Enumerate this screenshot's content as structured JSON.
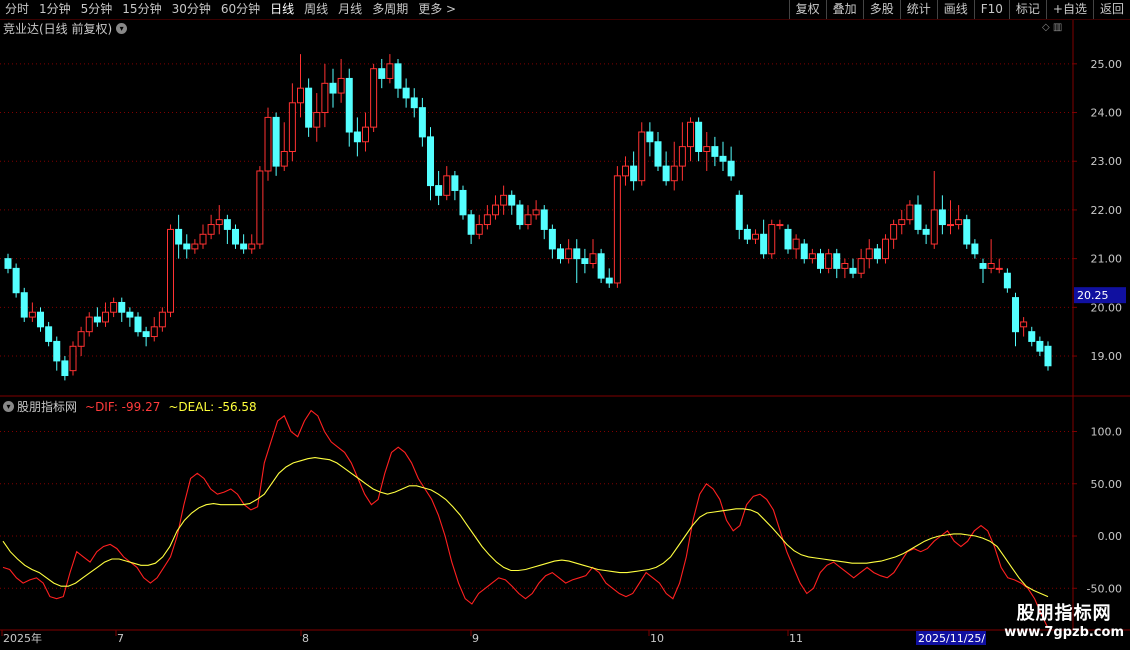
{
  "toolbar": {
    "periods": [
      "分时",
      "1分钟",
      "5分钟",
      "15分钟",
      "30分钟",
      "60分钟",
      "日线",
      "周线",
      "月线",
      "多周期",
      "更多 >"
    ],
    "active_period": "日线",
    "tools": [
      "复权",
      "叠加",
      "多股",
      "统计",
      "画线",
      "F10",
      "标记",
      "+自选",
      "返回"
    ]
  },
  "price_panel": {
    "title": "竞业达(日线 前复权)",
    "current_price_tag": "20.25",
    "y_ticks": [
      "25.00",
      "24.00",
      "23.00",
      "22.00",
      "21.00",
      "20.00",
      "19.00"
    ]
  },
  "indicator_panel": {
    "name": "股朋指标网",
    "dif_label": "~DIF: -99.27",
    "deal_label": "~DEAL: -56.58",
    "y_ticks": [
      "100.0",
      "50.00",
      "0.00",
      "-50.00"
    ]
  },
  "x_axis": {
    "labels": [
      "2025年",
      "7",
      "8",
      "9",
      "10",
      "11",
      "2025/11/25/"
    ]
  },
  "watermark": {
    "line1": "股朋指标网",
    "line2": "www.7gpzb.com"
  },
  "colors": {
    "up": "#ff3232",
    "down": "#54ffff",
    "dif": "#ff2020",
    "deal": "#ffff40",
    "grid": "#800000",
    "axis_bg": "#000000",
    "price_tag_bg": "#1010a0"
  },
  "chart_data": [
    {
      "type": "candlestick",
      "title": "竞业达(日线 前复权)",
      "ylim": [
        18.2,
        25.9
      ],
      "candles": [
        [
          21.0,
          20.8,
          21.1,
          20.7
        ],
        [
          20.8,
          20.3,
          20.9,
          20.2
        ],
        [
          20.3,
          19.8,
          20.4,
          19.7
        ],
        [
          19.8,
          19.9,
          20.1,
          19.7
        ],
        [
          19.9,
          19.6,
          20.0,
          19.5
        ],
        [
          19.6,
          19.3,
          19.7,
          19.2
        ],
        [
          19.3,
          18.9,
          19.4,
          18.7
        ],
        [
          18.9,
          18.6,
          19.0,
          18.5
        ],
        [
          18.7,
          19.2,
          19.3,
          18.6
        ],
        [
          19.2,
          19.5,
          19.6,
          19.0
        ],
        [
          19.5,
          19.8,
          19.9,
          19.4
        ],
        [
          19.8,
          19.7,
          20.0,
          19.6
        ],
        [
          19.7,
          19.9,
          20.1,
          19.6
        ],
        [
          19.9,
          20.1,
          20.2,
          19.8
        ],
        [
          20.1,
          19.9,
          20.2,
          19.7
        ],
        [
          19.9,
          19.8,
          20.0,
          19.6
        ],
        [
          19.8,
          19.5,
          19.9,
          19.4
        ],
        [
          19.5,
          19.4,
          19.6,
          19.2
        ],
        [
          19.4,
          19.6,
          19.8,
          19.3
        ],
        [
          19.6,
          19.9,
          20.0,
          19.5
        ],
        [
          19.9,
          21.6,
          21.7,
          19.8
        ],
        [
          21.6,
          21.3,
          21.9,
          21.0
        ],
        [
          21.3,
          21.2,
          21.5,
          21.0
        ],
        [
          21.2,
          21.3,
          21.4,
          21.1
        ],
        [
          21.3,
          21.5,
          21.7,
          21.2
        ],
        [
          21.5,
          21.7,
          21.9,
          21.4
        ],
        [
          21.7,
          21.8,
          22.1,
          21.5
        ],
        [
          21.8,
          21.6,
          21.9,
          21.3
        ],
        [
          21.6,
          21.3,
          21.7,
          21.2
        ],
        [
          21.3,
          21.2,
          21.5,
          21.1
        ],
        [
          21.2,
          21.3,
          21.5,
          21.1
        ],
        [
          21.3,
          22.8,
          22.9,
          21.2
        ],
        [
          22.8,
          23.9,
          24.1,
          22.6
        ],
        [
          23.9,
          22.9,
          24.0,
          22.7
        ],
        [
          22.9,
          23.2,
          23.8,
          22.8
        ],
        [
          23.2,
          24.2,
          24.6,
          23.0
        ],
        [
          24.2,
          24.5,
          25.2,
          23.9
        ],
        [
          24.5,
          23.7,
          24.7,
          23.5
        ],
        [
          23.7,
          24.0,
          24.4,
          23.4
        ],
        [
          24.0,
          24.6,
          25.0,
          23.7
        ],
        [
          24.6,
          24.4,
          24.9,
          24.1
        ],
        [
          24.4,
          24.7,
          25.1,
          24.2
        ],
        [
          24.7,
          23.6,
          24.9,
          23.3
        ],
        [
          23.6,
          23.4,
          23.9,
          23.1
        ],
        [
          23.4,
          23.7,
          24.0,
          23.2
        ],
        [
          23.7,
          24.9,
          25.0,
          23.6
        ],
        [
          24.9,
          24.7,
          25.1,
          24.5
        ],
        [
          24.7,
          25.0,
          25.2,
          24.6
        ],
        [
          25.0,
          24.5,
          25.1,
          24.3
        ],
        [
          24.5,
          24.3,
          24.7,
          24.1
        ],
        [
          24.3,
          24.1,
          24.5,
          23.9
        ],
        [
          24.1,
          23.5,
          24.3,
          23.3
        ],
        [
          23.5,
          22.5,
          23.7,
          22.2
        ],
        [
          22.5,
          22.3,
          22.8,
          22.1
        ],
        [
          22.3,
          22.7,
          22.9,
          22.2
        ],
        [
          22.7,
          22.4,
          22.8,
          22.2
        ],
        [
          22.4,
          21.9,
          22.5,
          21.8
        ],
        [
          21.9,
          21.5,
          22.0,
          21.3
        ],
        [
          21.5,
          21.7,
          21.9,
          21.4
        ],
        [
          21.7,
          21.9,
          22.1,
          21.6
        ],
        [
          21.9,
          22.1,
          22.3,
          21.8
        ],
        [
          22.1,
          22.3,
          22.5,
          21.9
        ],
        [
          22.3,
          22.1,
          22.4,
          21.9
        ],
        [
          22.1,
          21.7,
          22.2,
          21.6
        ],
        [
          21.7,
          21.9,
          22.1,
          21.6
        ],
        [
          21.9,
          22.0,
          22.2,
          21.8
        ],
        [
          22.0,
          21.6,
          22.1,
          21.4
        ],
        [
          21.6,
          21.2,
          21.7,
          21.0
        ],
        [
          21.2,
          21.0,
          21.3,
          20.9
        ],
        [
          21.0,
          21.2,
          21.4,
          20.9
        ],
        [
          21.2,
          21.0,
          21.4,
          20.5
        ],
        [
          21.0,
          20.9,
          21.2,
          20.7
        ],
        [
          20.9,
          21.1,
          21.4,
          20.8
        ],
        [
          21.1,
          20.6,
          21.2,
          20.5
        ],
        [
          20.6,
          20.5,
          20.8,
          20.4
        ],
        [
          20.5,
          22.7,
          22.9,
          20.4
        ],
        [
          22.7,
          22.9,
          23.1,
          22.5
        ],
        [
          22.9,
          22.6,
          23.2,
          22.4
        ],
        [
          22.6,
          23.6,
          23.8,
          22.5
        ],
        [
          23.6,
          23.4,
          23.8,
          23.1
        ],
        [
          23.4,
          22.9,
          23.6,
          22.8
        ],
        [
          22.9,
          22.6,
          23.2,
          22.5
        ],
        [
          22.6,
          22.9,
          23.4,
          22.4
        ],
        [
          22.9,
          23.3,
          23.8,
          22.6
        ],
        [
          23.3,
          23.8,
          23.9,
          23.0
        ],
        [
          23.8,
          23.2,
          23.9,
          23.0
        ],
        [
          23.2,
          23.3,
          23.6,
          22.8
        ],
        [
          23.3,
          23.1,
          23.5,
          22.9
        ],
        [
          23.1,
          23.0,
          23.4,
          22.8
        ],
        [
          23.0,
          22.7,
          23.3,
          22.6
        ],
        [
          22.3,
          21.6,
          22.4,
          21.4
        ],
        [
          21.6,
          21.4,
          21.7,
          21.3
        ],
        [
          21.4,
          21.5,
          21.6,
          21.3
        ],
        [
          21.5,
          21.1,
          21.8,
          21.0
        ],
        [
          21.1,
          21.7,
          21.8,
          21.0
        ],
        [
          21.7,
          21.7,
          21.8,
          21.6
        ],
        [
          21.6,
          21.2,
          21.7,
          21.1
        ],
        [
          21.2,
          21.4,
          21.5,
          21.0
        ],
        [
          21.3,
          21.0,
          21.4,
          20.9
        ],
        [
          21.0,
          21.1,
          21.2,
          20.9
        ],
        [
          21.1,
          20.8,
          21.2,
          20.7
        ],
        [
          20.8,
          21.1,
          21.2,
          20.7
        ],
        [
          21.1,
          20.8,
          21.2,
          20.6
        ],
        [
          20.8,
          20.9,
          21.0,
          20.6
        ],
        [
          20.8,
          20.7,
          21.0,
          20.6
        ],
        [
          20.7,
          21.0,
          21.2,
          20.6
        ],
        [
          21.0,
          21.2,
          21.4,
          20.8
        ],
        [
          21.2,
          21.0,
          21.3,
          20.9
        ],
        [
          21.0,
          21.4,
          21.5,
          20.9
        ],
        [
          21.4,
          21.7,
          21.8,
          21.2
        ],
        [
          21.7,
          21.8,
          22.0,
          21.5
        ],
        [
          21.8,
          22.1,
          22.2,
          21.7
        ],
        [
          22.1,
          21.6,
          22.3,
          21.5
        ],
        [
          21.6,
          21.5,
          21.7,
          21.3
        ],
        [
          21.3,
          22.0,
          22.8,
          21.2
        ],
        [
          22.0,
          21.7,
          22.3,
          21.5
        ],
        [
          21.7,
          21.7,
          22.2,
          21.5
        ],
        [
          21.7,
          21.8,
          22.1,
          21.6
        ],
        [
          21.8,
          21.3,
          21.9,
          21.2
        ],
        [
          21.3,
          21.1,
          21.4,
          21.0
        ],
        [
          20.9,
          20.8,
          21.0,
          20.5
        ],
        [
          20.8,
          20.9,
          21.4,
          20.7
        ],
        [
          20.8,
          20.8,
          21.0,
          20.7
        ],
        [
          20.7,
          20.4,
          20.8,
          20.3
        ],
        [
          20.2,
          19.5,
          20.3,
          19.2
        ],
        [
          19.6,
          19.7,
          19.8,
          19.4
        ],
        [
          19.5,
          19.3,
          19.6,
          19.2
        ],
        [
          19.3,
          19.1,
          19.4,
          19.0
        ],
        [
          19.2,
          18.8,
          19.3,
          18.7
        ]
      ]
    },
    {
      "type": "line",
      "title": "股朋指标网",
      "ylim": [
        -88,
        133
      ],
      "series": [
        {
          "name": "DIF",
          "values": [
            -30,
            -32,
            -40,
            -45,
            -42,
            -40,
            -45,
            -58,
            -60,
            -58,
            -35,
            -15,
            -20,
            -25,
            -15,
            -10,
            -8,
            -12,
            -20,
            -25,
            -30,
            -40,
            -45,
            -40,
            -30,
            -20,
            0,
            30,
            55,
            60,
            55,
            45,
            40,
            42,
            45,
            40,
            30,
            25,
            28,
            70,
            90,
            110,
            115,
            100,
            95,
            110,
            120,
            115,
            100,
            90,
            85,
            80,
            70,
            55,
            40,
            30,
            35,
            60,
            80,
            85,
            80,
            70,
            55,
            45,
            35,
            20,
            0,
            -25,
            -45,
            -60,
            -65,
            -55,
            -50,
            -45,
            -40,
            -42,
            -48,
            -55,
            -60,
            -55,
            -45,
            -38,
            -35,
            -40,
            -45,
            -42,
            -40,
            -38,
            -30,
            -35,
            -45,
            -50,
            -55,
            -58,
            -55,
            -45,
            -35,
            -40,
            -45,
            -55,
            -60,
            -45,
            -20,
            15,
            40,
            50,
            45,
            35,
            15,
            5,
            10,
            30,
            38,
            40,
            35,
            25,
            5,
            -15,
            -30,
            -45,
            -55,
            -50,
            -35,
            -28,
            -25,
            -30,
            -35,
            -40,
            -35,
            -30,
            -35,
            -38,
            -40,
            -35,
            -25,
            -15,
            -12,
            -15,
            -12,
            -5,
            0,
            5,
            -5,
            -10,
            -5,
            5,
            10,
            5,
            -10,
            -30,
            -40,
            -42,
            -45,
            -50,
            -60,
            -75,
            -88
          ]
        },
        {
          "name": "DEAL",
          "values": [
            -5,
            -15,
            -22,
            -28,
            -32,
            -35,
            -40,
            -45,
            -48,
            -48,
            -45,
            -40,
            -35,
            -30,
            -25,
            -22,
            -22,
            -24,
            -26,
            -28,
            -28,
            -26,
            -20,
            -10,
            5,
            15,
            22,
            27,
            30,
            31,
            30,
            30,
            30,
            30,
            31,
            35,
            40,
            50,
            60,
            66,
            70,
            72,
            74,
            75,
            74,
            73,
            70,
            65,
            60,
            55,
            50,
            45,
            42,
            40,
            42,
            45,
            48,
            48,
            46,
            44,
            40,
            35,
            28,
            20,
            10,
            0,
            -10,
            -18,
            -25,
            -30,
            -33,
            -33,
            -32,
            -30,
            -28,
            -26,
            -24,
            -23,
            -24,
            -26,
            -28,
            -30,
            -32,
            -33,
            -34,
            -35,
            -35,
            -34,
            -33,
            -32,
            -30,
            -26,
            -20,
            -10,
            0,
            10,
            18,
            22,
            23,
            24,
            25,
            26,
            26,
            25,
            22,
            15,
            8,
            0,
            -8,
            -14,
            -18,
            -20,
            -21,
            -22,
            -23,
            -24,
            -25,
            -26,
            -26,
            -26,
            -25,
            -24,
            -22,
            -20,
            -17,
            -13,
            -9,
            -5,
            -2,
            0,
            1,
            2,
            2,
            1,
            0,
            -2,
            -5,
            -10,
            -20,
            -30,
            -40,
            -48,
            -52,
            -55,
            -58
          ]
        }
      ]
    }
  ]
}
